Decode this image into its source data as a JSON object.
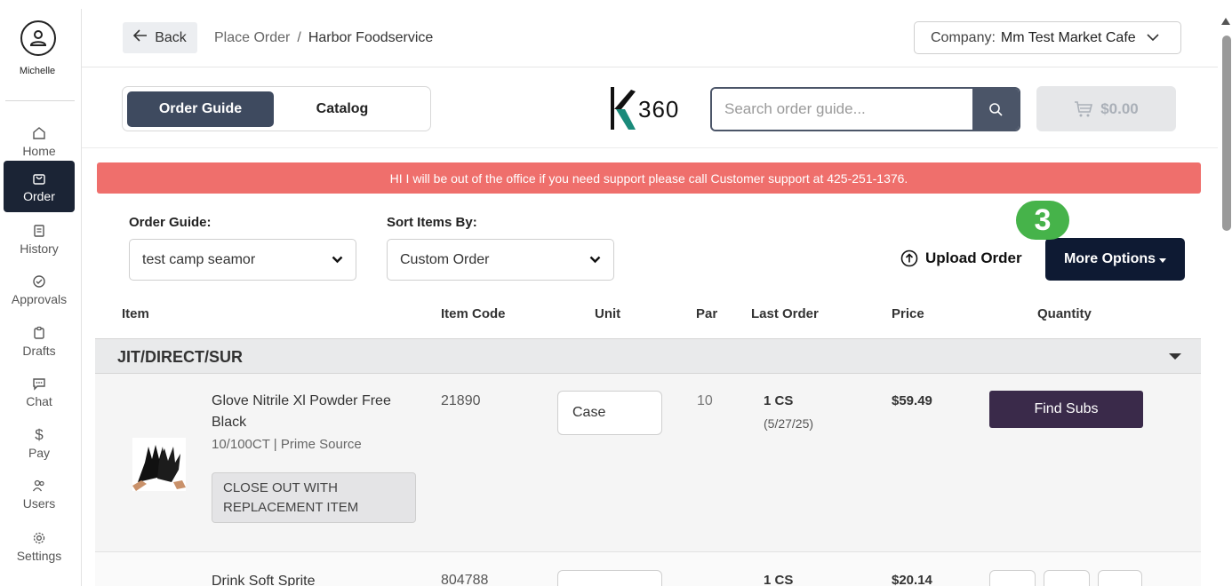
{
  "user": {
    "name": "Michelle"
  },
  "nav": [
    {
      "label": "Home",
      "icon": "home-icon"
    },
    {
      "label": "Order",
      "icon": "bag-icon",
      "active": true
    },
    {
      "label": "History",
      "icon": "document-icon"
    },
    {
      "label": "Approvals",
      "icon": "check-circle-icon"
    },
    {
      "label": "Drafts",
      "icon": "clipboard-icon"
    },
    {
      "label": "Chat",
      "icon": "chat-icon"
    },
    {
      "label": "Pay",
      "icon": "dollar-icon"
    },
    {
      "label": "Users",
      "icon": "users-icon"
    },
    {
      "label": "Settings",
      "icon": "gear-icon"
    }
  ],
  "header": {
    "back_label": "Back",
    "breadcrumb": [
      "Place Order",
      "/",
      "Harbor Foodservice"
    ],
    "company_label": "Company:",
    "company_value": "Mm Test Market Cafe"
  },
  "toolbar": {
    "tab_active": "Order Guide",
    "tab_other": "Catalog",
    "logo_text": "360",
    "search_placeholder": "Search order guide...",
    "cart_total": "$0.00"
  },
  "banner": "HI I will be out of the office if you need support please call Customer support at 425-251-1376.",
  "filters": {
    "order_guide_label": "Order Guide:",
    "order_guide_value": "test camp seamor",
    "sort_label": "Sort Items By:",
    "sort_value": "Custom Order",
    "upload_label": "Upload Order",
    "more_options_label": "More Options",
    "step_badge": "3"
  },
  "table": {
    "headers": [
      "Item",
      "Item Code",
      "Unit",
      "Par",
      "Last Order",
      "Price",
      "Quantity"
    ],
    "group": "JIT/DIRECT/SUR",
    "rows": [
      {
        "name_line1": "Glove Nitrile Xl Powder Free",
        "name_line2": "Black",
        "details": "10/100CT | Prime Source",
        "tag_line1": "CLOSE OUT WITH",
        "tag_line2": "REPLACEMENT ITEM",
        "code": "21890",
        "unit": "Case",
        "par": "10",
        "last_order": "1 CS",
        "last_order_date": "(5/27/25)",
        "price": "$59.49",
        "action": "Find Subs"
      },
      {
        "name_line1": "Drink Soft Sprite",
        "code": "804788",
        "last_order": "1 CS",
        "price": "$20.14"
      }
    ]
  }
}
